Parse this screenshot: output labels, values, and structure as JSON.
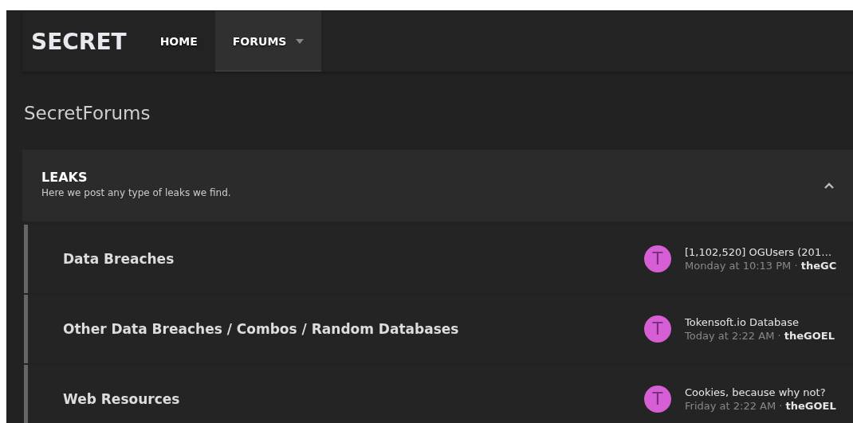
{
  "nav": {
    "logo": "SECRET",
    "tabs": [
      {
        "label": "HOME",
        "selected": false,
        "has_menu": false
      },
      {
        "label": "FORUMS",
        "selected": true,
        "has_menu": true
      }
    ]
  },
  "page_title": "SecretForums",
  "category": {
    "title": "LEAKS",
    "description": "Here we post any type of leaks we find.",
    "expanded": true,
    "forums": [
      {
        "name": "Data Breaches",
        "avatar": "T",
        "color": "#d65fd6",
        "latest_title": "[1,102,520] OGUsers (201…",
        "latest_time": "Monday at 10:13 PM ·",
        "latest_user": "theGC"
      },
      {
        "name": "Other Data Breaches / Combos / Random Databases",
        "avatar": "T",
        "color": "#d65fd6",
        "latest_title": "Tokensoft.io Database",
        "latest_time": "Today at 2:22 AM ·",
        "latest_user": "theGOEL"
      },
      {
        "name": "Web Resources",
        "avatar": "T",
        "color": "#d65fd6",
        "latest_title": "Cookies, because why not?",
        "latest_time": "Friday at 2:22 AM ·",
        "latest_user": "theGOEL"
      }
    ]
  }
}
